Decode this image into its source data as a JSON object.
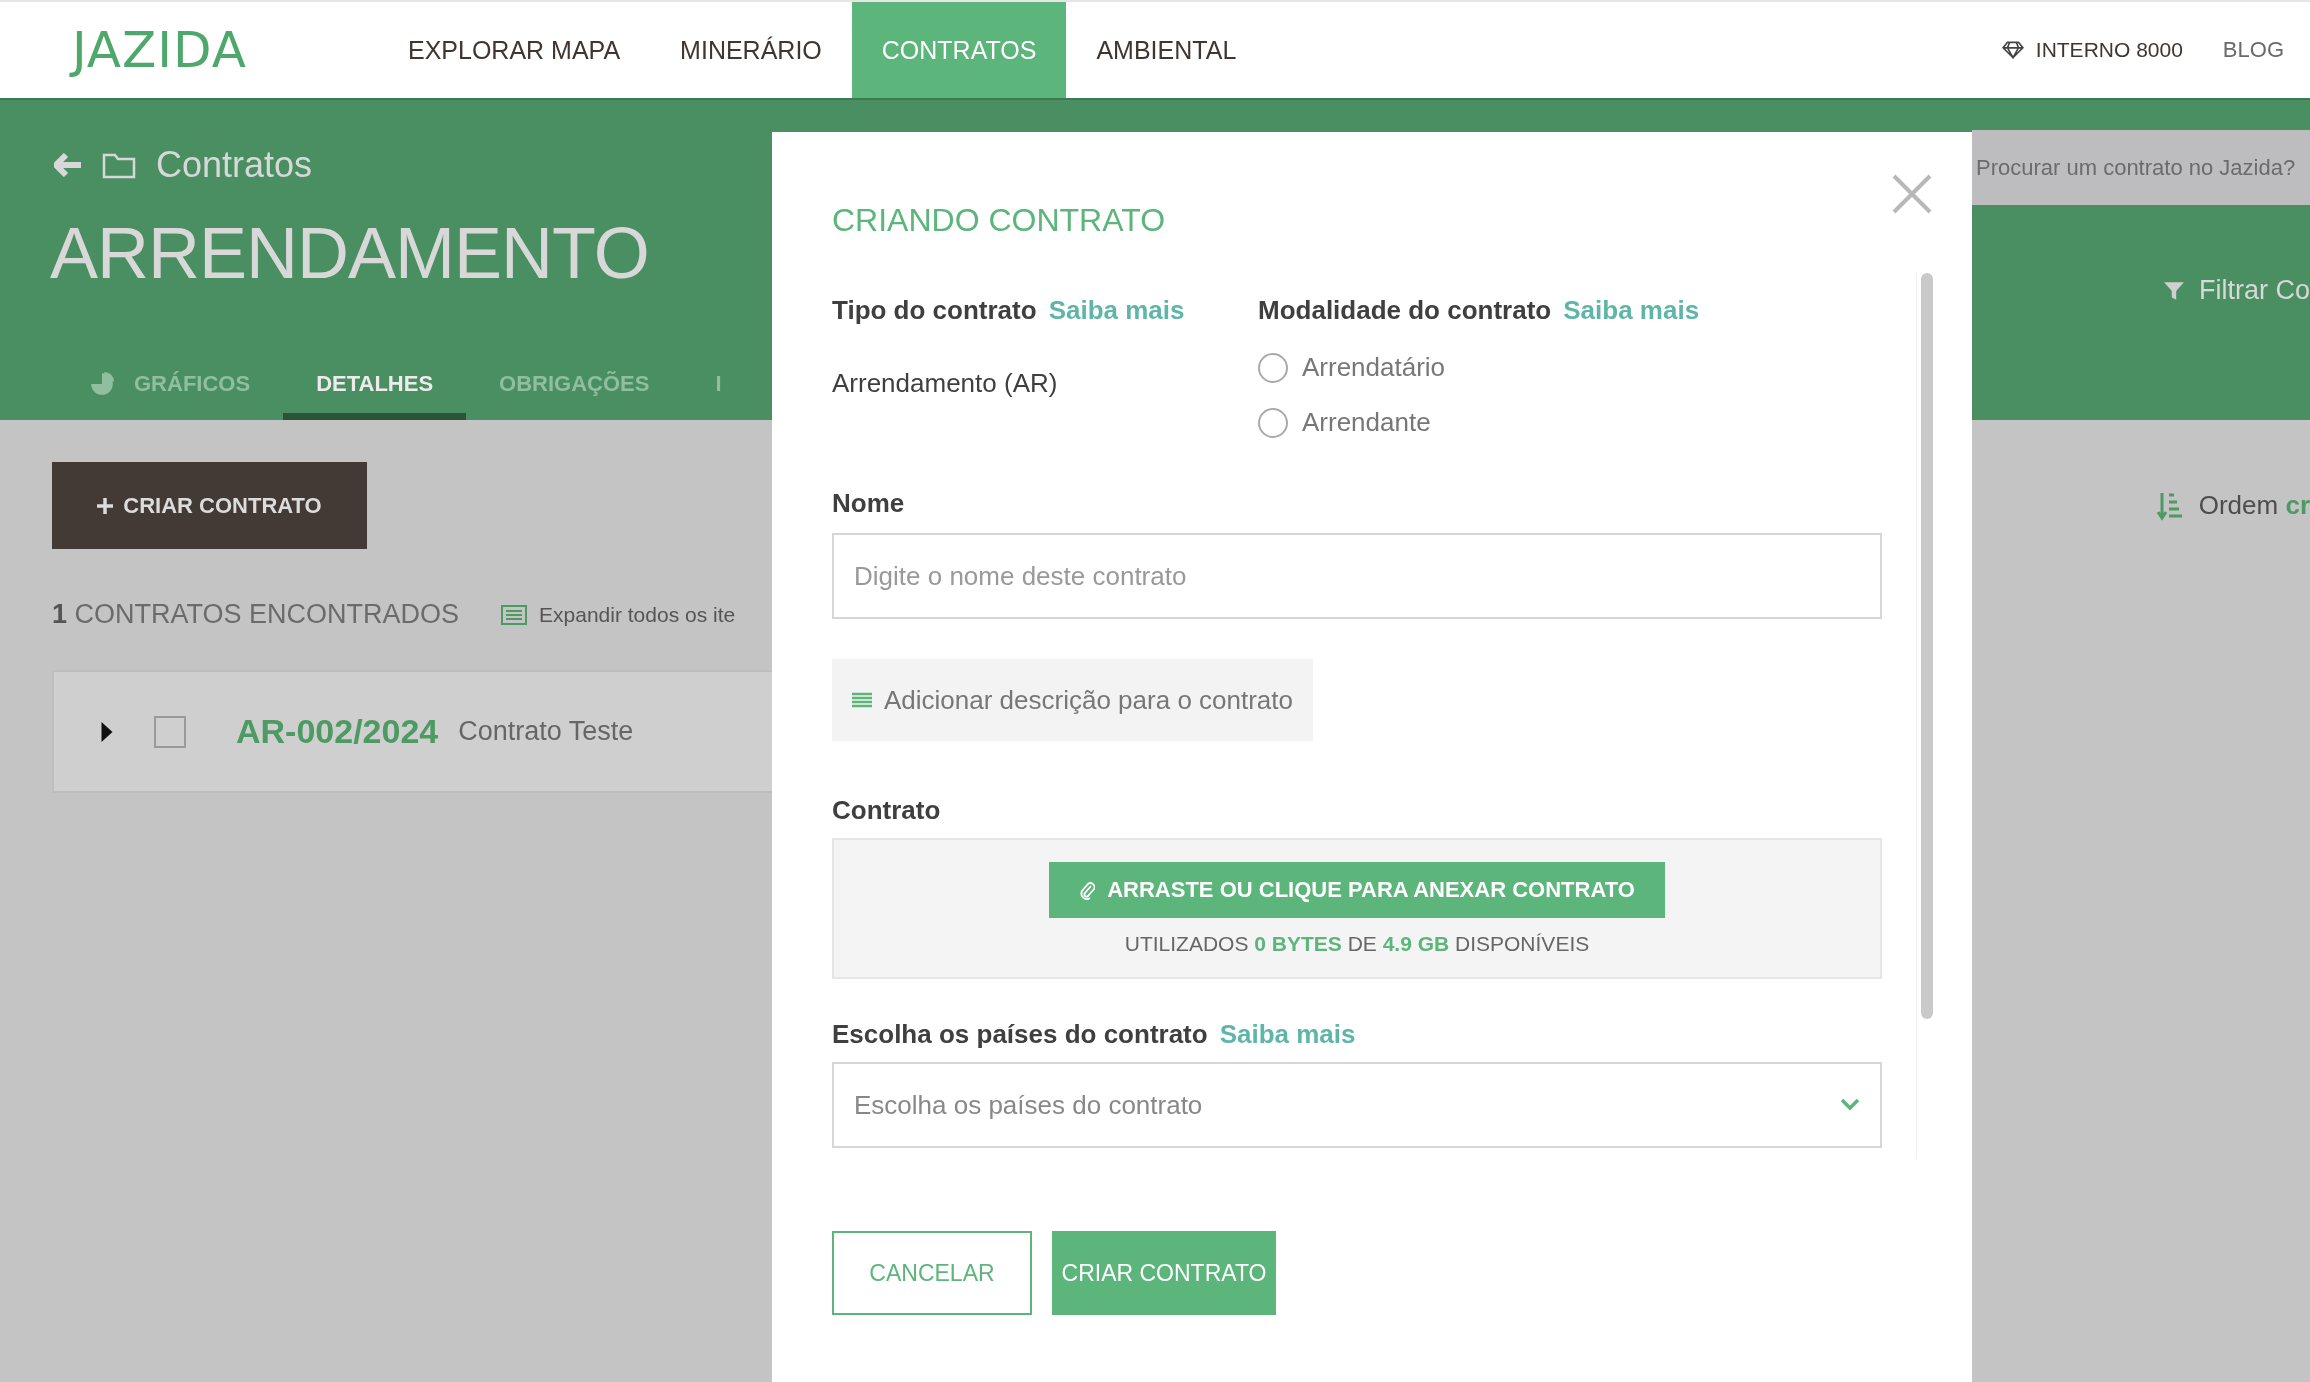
{
  "nav": {
    "logo": "JAZIDA",
    "items": [
      {
        "label": "EXPLORAR MAPA",
        "selected": false
      },
      {
        "label": "MINERÁRIO",
        "selected": false
      },
      {
        "label": "CONTRATOS",
        "selected": true
      },
      {
        "label": "AMBIENTAL",
        "selected": false
      }
    ],
    "plan": "INTERNO 8000",
    "blog": "BLOG"
  },
  "header": {
    "breadcrumb": "Contratos",
    "title": "ARRENDAMENTO",
    "search_placeholder": "Procurar um contrato no Jazida?",
    "filter": "Filtrar Co",
    "tabs": [
      {
        "label": "GRÁFICOS",
        "kind": "chart",
        "selected": false
      },
      {
        "label": "DETALHES",
        "kind": "plain",
        "selected": true
      },
      {
        "label": "OBRIGAÇÕES",
        "kind": "plain",
        "selected": false
      },
      {
        "label": "I",
        "kind": "plain",
        "selected": false
      }
    ]
  },
  "list": {
    "create_button": "CRIAR CONTRATO",
    "count": "1",
    "count_label": "CONTRATOS ENCONTRADOS",
    "expand": "Expandir todos os ite",
    "sort_label": "Ordem",
    "sort_value": "cr",
    "rows": [
      {
        "code": "AR-002/2024",
        "name": "Contrato Teste",
        "checked": false
      }
    ]
  },
  "modal": {
    "title": "CRIANDO CONTRATO",
    "type": {
      "label": "Tipo do contrato",
      "link": "Saiba mais",
      "value": "Arrendamento (AR)"
    },
    "mode": {
      "label": "Modalidade do contrato",
      "link": "Saiba mais",
      "options": [
        {
          "label": "Arrendatário",
          "selected": false
        },
        {
          "label": "Arrendante",
          "selected": false
        }
      ]
    },
    "name": {
      "label": "Nome",
      "placeholder": "Digite o nome deste contrato"
    },
    "description_button": "Adicionar descrição para o contrato",
    "file": {
      "label": "Contrato",
      "button": "ARRASTE OU CLIQUE PARA ANEXAR CONTRATO",
      "usage": "UTILIZADOS **0 BYTES** DE **4.9 GB** DISPONÍVEIS"
    },
    "countries": {
      "label": "Escolha os países do contrato",
      "link": "Saiba mais",
      "placeholder": "Escolha os países do contrato"
    },
    "cancel": "CANCELAR",
    "submit": "CRIAR CONTRATO"
  }
}
